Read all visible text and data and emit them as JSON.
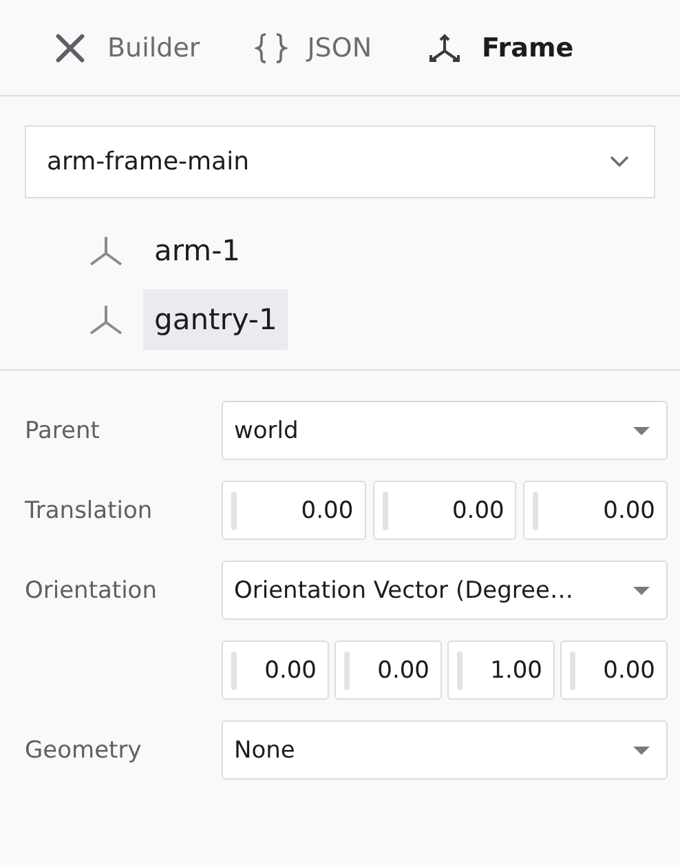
{
  "tabs": [
    {
      "label": "Builder",
      "selected": false
    },
    {
      "label": "JSON",
      "selected": false
    },
    {
      "label": "Frame",
      "selected": true
    }
  ],
  "frame_select": {
    "value": "arm-frame-main"
  },
  "frames": [
    {
      "label": "arm-1",
      "selected": false
    },
    {
      "label": "gantry-1",
      "selected": true
    }
  ],
  "form": {
    "rows": [
      {
        "kind": "select",
        "label": "Parent",
        "value": "world"
      },
      {
        "kind": "numbers",
        "label": "Translation",
        "values": [
          "0.00",
          "0.00",
          "0.00"
        ]
      },
      {
        "kind": "select",
        "label": "Orientation",
        "value": "Orientation Vector (Degree…"
      },
      {
        "kind": "numbers",
        "label": "",
        "values": [
          "0.00",
          "0.00",
          "1.00",
          "0.00"
        ]
      },
      {
        "kind": "select",
        "label": "Geometry",
        "value": "None"
      }
    ]
  }
}
